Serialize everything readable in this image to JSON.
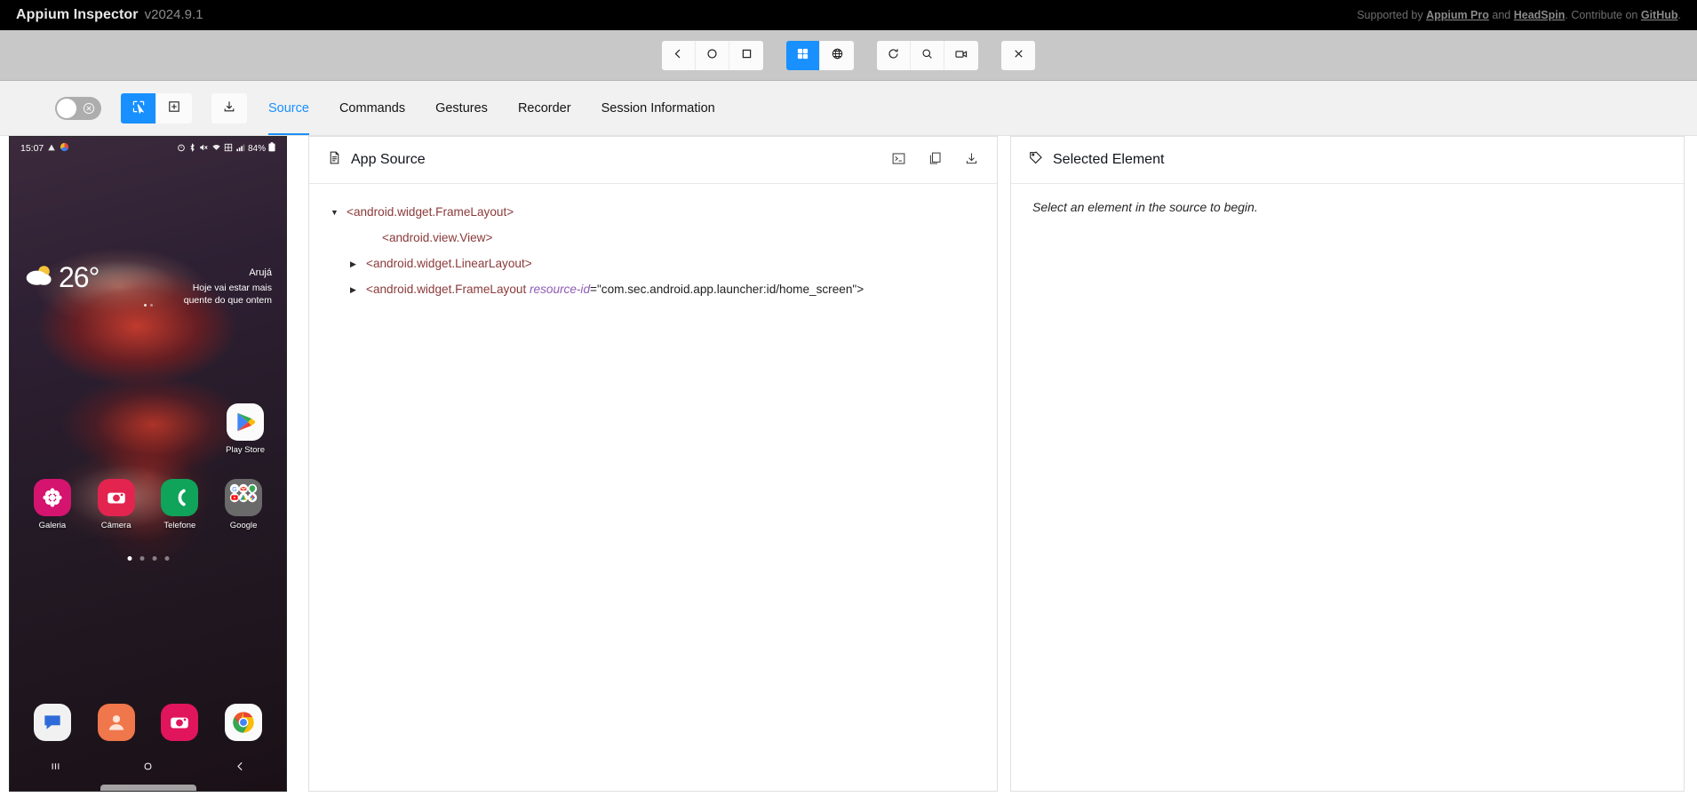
{
  "titlebar": {
    "app_name": "Appium Inspector",
    "version": "v2024.9.1",
    "supported_by_prefix": "Supported by ",
    "link_appium_pro": "Appium Pro",
    "and_text": " and ",
    "link_headspin": "HeadSpin",
    "contribute_text": ". Contribute on ",
    "link_github": "GitHub",
    "period": "."
  },
  "toolbar": {
    "back_label": "Back",
    "home_label": "Home",
    "recent_apps_label": "App Switch",
    "app_mode_label": "Native App Mode",
    "web_mode_label": "Web View Mode",
    "refresh_label": "Refresh Source",
    "search_label": "Search for Element",
    "record_label": "Start Recording",
    "quit_label": "Quit Session"
  },
  "secondbar": {
    "toggle_label": "Enable Sibling Actions",
    "select_label": "Select Elements",
    "swipe_label": "Tap/Swipe By Coordinates",
    "screenshot_label": "Save Screenshot"
  },
  "tabs": [
    {
      "label": "Source",
      "active": true
    },
    {
      "label": "Commands",
      "active": false
    },
    {
      "label": "Gestures",
      "active": false
    },
    {
      "label": "Recorder",
      "active": false
    },
    {
      "label": "Session Information",
      "active": false
    }
  ],
  "app_source": {
    "title": "App Source",
    "action_console": "Open Console",
    "action_copy": "Copy XML",
    "action_download": "Download XML",
    "tree": [
      {
        "indent": 0,
        "caret": "down",
        "tag_open": "<android.widget.FrameLayout>",
        "attr_name": "",
        "attr_value": ""
      },
      {
        "indent": 1,
        "caret": "none",
        "tag_open": "<android.view.View>",
        "attr_name": "",
        "attr_value": ""
      },
      {
        "indent": 0,
        "caret": "right",
        "tag_open": "<android.widget.LinearLayout>",
        "attr_name": "",
        "attr_value": ""
      },
      {
        "indent": 0,
        "caret": "right",
        "tag_open": "<android.widget.FrameLayout ",
        "attr_name": "resource-id",
        "attr_value": "=\"com.sec.android.app.launcher:id/home_screen\">"
      }
    ]
  },
  "selected_element": {
    "title": "Selected Element",
    "empty_message": "Select an element in the source to begin."
  },
  "device": {
    "status_bar": {
      "time": "15:07",
      "battery": "84%"
    },
    "weather": {
      "temperature": "26°",
      "city": "Arujá",
      "message_line1": "Hoje vai estar mais",
      "message_line2": "quente do que ontem"
    },
    "playstore": {
      "label": "Play Store"
    },
    "apps": [
      {
        "label": "Galeria"
      },
      {
        "label": "Câmera"
      },
      {
        "label": "Telefone"
      },
      {
        "label": "Google"
      }
    ],
    "dock": [
      {
        "label": "Messages"
      },
      {
        "label": "Contacts"
      },
      {
        "label": "Camera"
      },
      {
        "label": "Chrome"
      }
    ],
    "page_count": 4,
    "active_page": 1,
    "nav": {
      "recents": "|||",
      "home": "home",
      "back": "back"
    }
  },
  "colors": {
    "accent": "#1890ff",
    "titlebar_bg": "#000000",
    "toolbar_bg": "#c8c8c8",
    "tag_color": "#8b3a3a",
    "attr_color": "#8e5bb5"
  }
}
